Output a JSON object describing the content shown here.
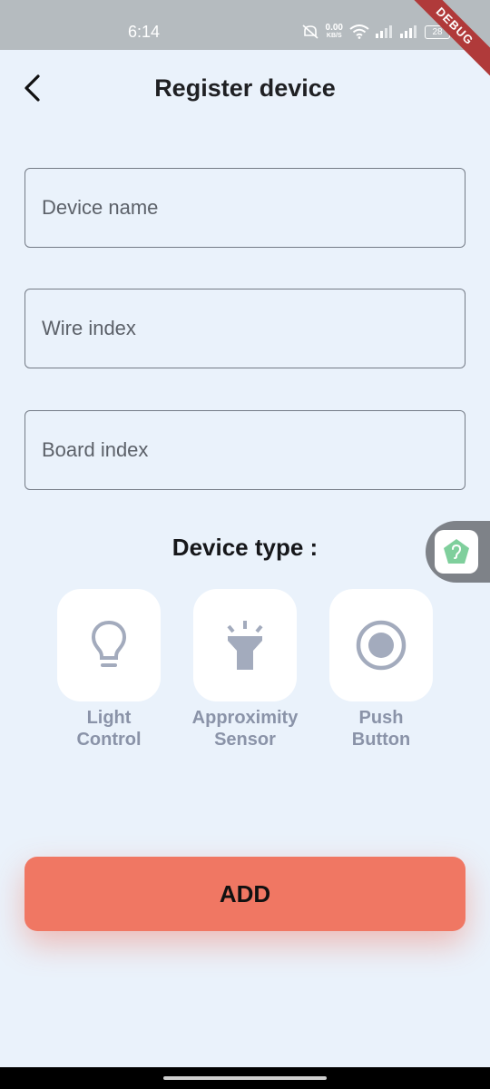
{
  "status_bar": {
    "time": "6:14",
    "net_speed": "0.00",
    "net_unit": "KB/S",
    "battery": "28"
  },
  "debug_banner": "DEBUG",
  "header": {
    "title": "Register device",
    "back_icon": "chevron-left-icon"
  },
  "form": {
    "device_name_placeholder": "Device name",
    "wire_index_placeholder": "Wire index",
    "board_index_placeholder": "Board index",
    "device_name_value": "",
    "wire_index_value": "",
    "board_index_value": ""
  },
  "device_type": {
    "label": "Device type :",
    "options": [
      {
        "line1": "Light",
        "line2": "Control",
        "icon": "lightbulb-icon"
      },
      {
        "line1": "Approximity",
        "line2": "Sensor",
        "icon": "flashlight-icon"
      },
      {
        "line1": "Push",
        "line2": "Button",
        "icon": "radio-button-icon"
      }
    ]
  },
  "add_button_label": "ADD",
  "colors": {
    "background": "#eaf2fb",
    "accent": "#f07763",
    "icon": "#a3abbd",
    "label": "#8a93a8"
  }
}
